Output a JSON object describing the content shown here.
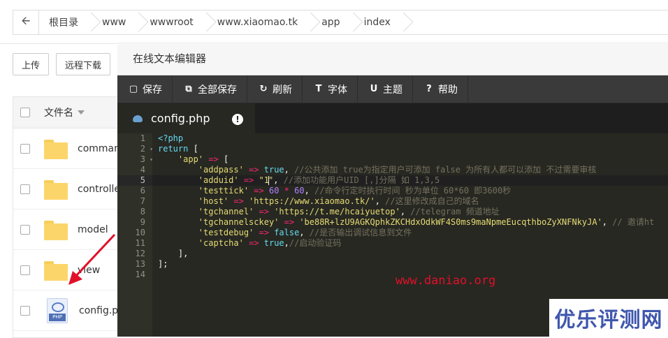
{
  "breadcrumb": {
    "items": [
      "根目录",
      "www",
      "wwwroot",
      "www.xiaomao.tk",
      "app",
      "index"
    ]
  },
  "toolbar": {
    "upload": "上传",
    "remote_download": "远程下载"
  },
  "file_list": {
    "header": "文件名",
    "rows": [
      {
        "name": "comman",
        "type": "folder"
      },
      {
        "name": "controlle",
        "type": "folder"
      },
      {
        "name": "model",
        "type": "folder"
      },
      {
        "name": "view",
        "type": "folder"
      },
      {
        "name": "config.ph",
        "type": "php",
        "icon_text": "PHP"
      }
    ]
  },
  "editor": {
    "title": "在线文本编辑器",
    "buttons": [
      "保存",
      "全部保存",
      "刷新",
      "字体",
      "主题",
      "帮助"
    ],
    "tab": {
      "filename": "config.php",
      "warning": "!"
    },
    "line_numbers": [
      "1",
      "2",
      "3",
      "4",
      "5",
      "6",
      "7",
      "8",
      "9",
      "10",
      "11",
      "12",
      "13",
      "14"
    ],
    "code_lines": [
      "<?php",
      "return [",
      "    'app' => [",
      "        'addpass' => true, //公共添加 true为指定用户可添加 false 为所有人都可以添加 不过需要审核",
      "        'adduid' => \"1\", //添加功能用户UID [,]分隔 如 1,3,5",
      "        'testtick' => 60 * 60, //命令行定时执行时间 秒为单位 60*60 即3600秒",
      "        'host' => 'https://www.xiaomao.tk/', //这里修改成自己的域名",
      "        'tgchannel' => 'https://t.me/hcaiyuetop', //telegram 频道地址",
      "        'tgchannelsckey' => 'be88R+lzU9AGKQphkZKCHdxOdkWF4S0ms9maNpmeEucqthboZyXNFNkyJA', // 邀请ht",
      "        'testdebug' => false, //是否输出调试信息到文件",
      "        'captcha' => true,//启动验证码",
      "    ],",
      "];",
      ""
    ]
  },
  "watermarks": {
    "url": "www.daniao.org",
    "brand": "优乐评测网"
  },
  "colors": {
    "editor_bg": "#272822",
    "keyword": "#66d9ef",
    "string": "#e6db74",
    "operator": "#f92672",
    "number": "#ae81ff",
    "comment": "#75715e",
    "watermark_url": "#e0102a",
    "watermark_brand": "#3f57ad",
    "arrow": "#e0102a"
  }
}
